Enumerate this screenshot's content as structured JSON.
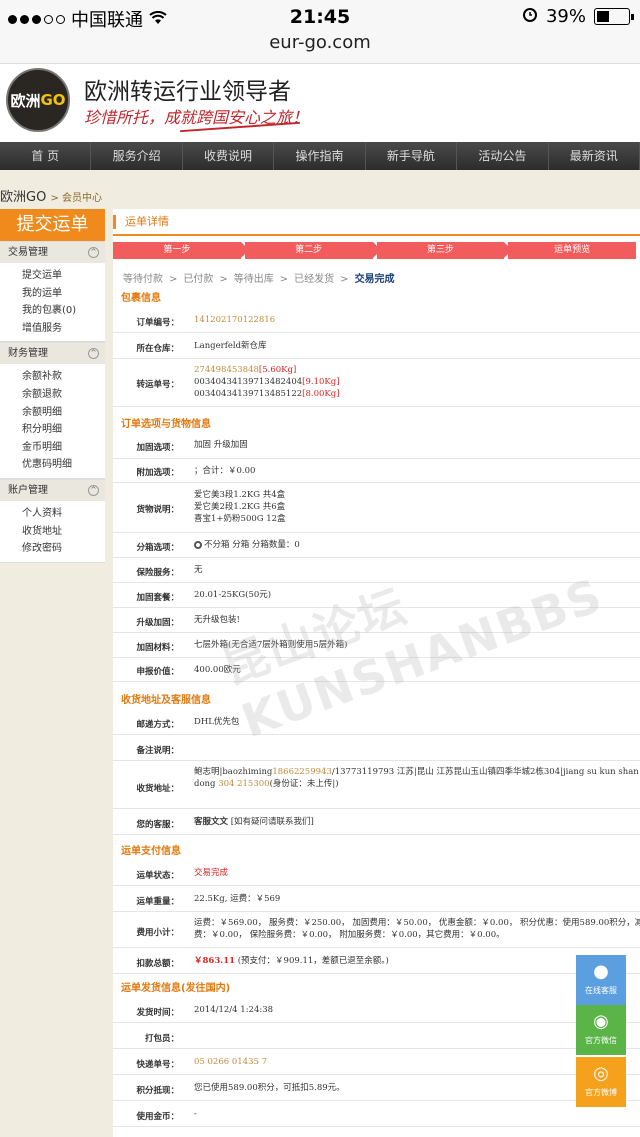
{
  "status_bar": {
    "carrier": "中国联通",
    "time": "21:45",
    "battery": "39%",
    "battery_level": 0.39,
    "url": "eur-go.com"
  },
  "header": {
    "logo_text": "欧洲",
    "logo_accent": "GO",
    "title": "欧洲转运行业领导者",
    "slogan": "珍惜所托，成就跨国安心之旅！"
  },
  "nav": [
    "首 页",
    "服务介绍",
    "收费说明",
    "操作指南",
    "新手导航",
    "活动公告",
    "最新资讯"
  ],
  "breadcrumb": {
    "site": "欧洲GO",
    "current": "> 会员中心"
  },
  "sidebar": {
    "submit_label": "提交运单",
    "groups": [
      {
        "title": "交易管理",
        "items": [
          "提交运单",
          "我的运单",
          "我的包裹(0)",
          "增值服务"
        ]
      },
      {
        "title": "财务管理",
        "items": [
          "余额补款",
          "余额退款",
          "余额明细",
          "积分明细",
          "金币明细",
          "优惠码明细"
        ]
      },
      {
        "title": "账户管理",
        "items": [
          "个人资料",
          "收货地址",
          "修改密码"
        ]
      }
    ]
  },
  "main": {
    "title": "运单详情",
    "steps": [
      "第一步",
      "第二步",
      "第三步",
      "运单预览"
    ],
    "progress": [
      "等待付款",
      "已付款",
      "等待出库",
      "已经发货",
      "交易完成"
    ],
    "progress_sep": ">",
    "sections": {
      "package": "包裹信息",
      "options": "订单选项与货物信息",
      "address": "收货地址及客服信息",
      "payment": "运单支付信息",
      "shipping": "运单发货信息(发往国内)"
    },
    "package": {
      "order_no_label": "订单编号：",
      "order_no": "141202170122816",
      "warehouse_label": "所在仓库：",
      "warehouse": "Langerfeld新仓库",
      "tracking_label": "转运单号：",
      "tracking": [
        {
          "no": "274498453848",
          "weight": "[5.60Kg]"
        },
        {
          "no": "00340434139713482404",
          "weight": "[9.10Kg]"
        },
        {
          "no": "00340434139713485122",
          "weight": "[8.00Kg]"
        }
      ]
    },
    "options": {
      "reinforce_label": "加固选项：",
      "reinforce": "加固     升级加固",
      "extra_label": "附加选项：",
      "extra": "；合计：￥0.00",
      "goods_label": "货物说明：",
      "goods": [
        "爱它美3段1.2KG 共4盒",
        "爱它美2段1.2KG 共6盒",
        "喜宝1+奶粉500G 12盒"
      ],
      "split_label": "分箱选项：",
      "split": "不分箱     分箱  分箱数量：0",
      "insurance_label": "保险服务：",
      "insurance": "无",
      "package_label": "加固套餐：",
      "package": "20.01-25KG(50元)",
      "upgrade_label": "升级加固：",
      "upgrade": "无升级包装!",
      "material_label": "加固材料：",
      "material": "七层外箱(无合适7层外箱则使用5层外箱)",
      "declare_label": "申报价值：",
      "declare": "400.00欧元"
    },
    "address": {
      "post_label": "邮递方式：",
      "post": "DHL优先包",
      "remark_label": "备注说明：",
      "remark": "",
      "recv_label": "收货地址：",
      "recv_name": "鲍志明|baozhiming",
      "recv_phone": "18662259943",
      "recv_rest": "/13773119793 江苏|昆山 江苏昆山玉山镇四季华城2栋304|jiang su kun shan yu shan zhen si ji h",
      "recv_line2_a": "dong ",
      "recv_zip": "304 215300",
      "recv_line2_b": "(身份证：未上传|)",
      "cs_label": "您的客服：",
      "cs_name": "客服文文",
      "cs_note": " [如有疑问请联系我们]"
    },
    "payment": {
      "status_label": "运单状态：",
      "status": "交易完成",
      "weight_label": "运单重量：",
      "weight": "22.5Kg, 运费：￥569",
      "fee_label": "费用小计：",
      "fee_line1": "运费：￥569.00，  服务费：￥250.00，  加固费用：￥50.00，  优惠金额：￥0.00，  积分优惠：使用589.00积分，减5.89元，",
      "fee_line2": "费：￥0.00，  保险服务费：￥0.00，  附加服务费：￥0.00，其它费用：￥0.00。",
      "total_label": "扣款总额：",
      "total_amount": "￥863.11",
      "total_note": " (预支付：￥909.11，差额已退至余额。)"
    },
    "shipping": {
      "time_label": "发货时间：",
      "time": "2014/12/4 1:24:38",
      "packer_label": "打包员：",
      "packer": "",
      "express_label": "快递单号：",
      "express": "05 0266 01435 7",
      "points_label": "积分抵现：",
      "points": "您已使用589.00积分，可抵扣5.89元。",
      "gold_label": "使用金币：",
      "gold": "-"
    }
  },
  "watermark": "昆山论坛 KUNSHANBBS",
  "float_buttons": {
    "kefu": "在线客服",
    "weixin": "官方微信",
    "weibo": "官方微博"
  }
}
